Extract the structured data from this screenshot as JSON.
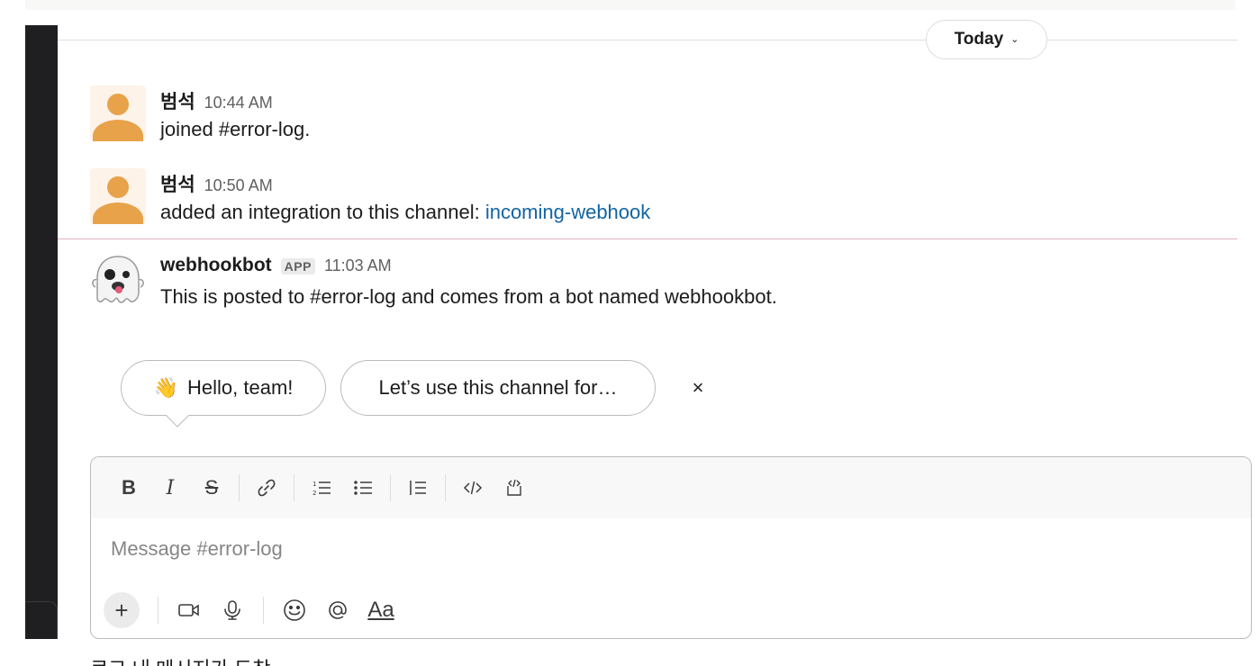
{
  "date_divider": {
    "label": "Today"
  },
  "messages": [
    {
      "author": "범석",
      "time": "10:44 AM",
      "text": "joined #error-log."
    },
    {
      "author": "범석",
      "time": "10:50 AM",
      "text": "added an integration to this channel: ",
      "link": "incoming-webhook"
    },
    {
      "author": "webhookbot",
      "badge": "APP",
      "time": "11:03 AM",
      "text": "This is posted to #error-log and comes from a bot named webhookbot."
    }
  ],
  "suggestions": {
    "hello_emoji": "👋",
    "hello": "Hello, team!",
    "channel": "Let’s use this channel for…",
    "dismiss": "×"
  },
  "composer": {
    "format": {
      "bold": "B",
      "italic": "I",
      "strike": "S"
    },
    "placeholder": "Message #error-log",
    "aa": "Aa",
    "plus": "+"
  },
  "icons": {
    "ghost": "ghost-emoji-icon",
    "link": "link-icon",
    "ordered_list": "ordered-list-icon",
    "bullet_list": "bullet-list-icon",
    "blockquote": "blockquote-icon",
    "code": "code-icon",
    "code_block": "code-block-icon",
    "video": "video-icon",
    "mic": "microphone-icon",
    "emoji": "emoji-icon",
    "mention": "at-mention-icon"
  },
  "colors": {
    "link": "#1264a3",
    "avatar": "#e8a24a",
    "new_divider": "#e8b0be"
  },
  "footer_text": "로그 내 메시지가 도착"
}
